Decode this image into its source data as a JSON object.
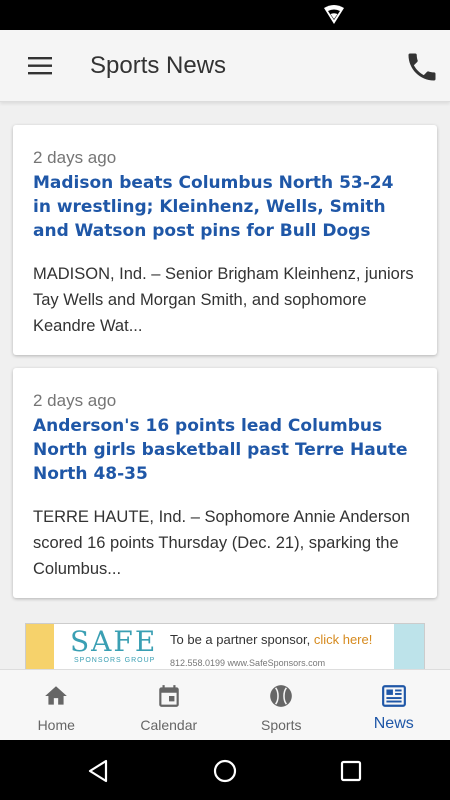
{
  "app_bar": {
    "title": "Sports News",
    "menu_icon": "hamburger-menu-icon",
    "phone_icon": "phone-icon"
  },
  "articles": [
    {
      "time": "2 days ago",
      "title": "Madison beats Columbus North 53-24 in wrestling; Kleinhenz, Wells, Smith and Watson post pins for Bull Dogs",
      "excerpt": "MADISON, Ind. – Senior Brigham Kleinhenz, juniors Tay Wells and Morgan Smith, and sophomore Keandre Wat..."
    },
    {
      "time": "2 days ago",
      "title": "Anderson's 16 points lead Columbus North girls basketball past Terre Haute North 48-35",
      "excerpt": "TERRE HAUTE, Ind. – Sophomore Annie Anderson scored 16 points Thursday (Dec. 21), sparking the Columbus..."
    }
  ],
  "ad": {
    "logo": "SAFE",
    "group": "SPONSORS GROUP",
    "text": "To be a partner sponsor,",
    "link": "click here!",
    "contact": "812.558.0199   www.SafeSponsors.com"
  },
  "bottom_nav": {
    "items": [
      {
        "label": "Home",
        "icon": "home-icon"
      },
      {
        "label": "Calendar",
        "icon": "calendar-icon"
      },
      {
        "label": "Sports",
        "icon": "sports-ball-icon"
      },
      {
        "label": "News",
        "icon": "newspaper-icon"
      }
    ],
    "active": "News"
  },
  "colors": {
    "accent": "#1f57a7",
    "status_bar": "#000000",
    "app_bar": "#f5f5f5"
  }
}
